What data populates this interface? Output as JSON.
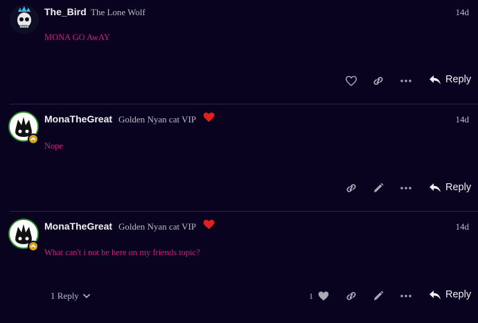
{
  "posts": [
    {
      "username": "The_Bird",
      "title": "The Lone Wolf",
      "date": "14d",
      "content": "MONA GO AwAY",
      "reply_label": "Reply"
    },
    {
      "username": "MonaTheGreat",
      "title": "Golden Nyan cat VIP",
      "date": "14d",
      "content": "Nope",
      "reply_label": "Reply"
    },
    {
      "username": "MonaTheGreat",
      "title": "Golden Nyan cat VIP",
      "date": "14d",
      "content": "What can't i not be here on my friends topic?",
      "reply_label": "Reply",
      "replies_toggle": "1 Reply",
      "like_count": "1"
    }
  ],
  "icons": {
    "like": "heart-icon",
    "link": "link-icon",
    "more": "ellipsis-icon",
    "edit": "pencil-icon",
    "reply": "reply-arrow-icon",
    "flair": "red-heart-icon",
    "toggle": "chevron-down-icon"
  },
  "colors": {
    "background": "#09031f",
    "post_text": "#d01f7f",
    "flair_heart": "#e0201f",
    "badge": "#d4a017"
  }
}
